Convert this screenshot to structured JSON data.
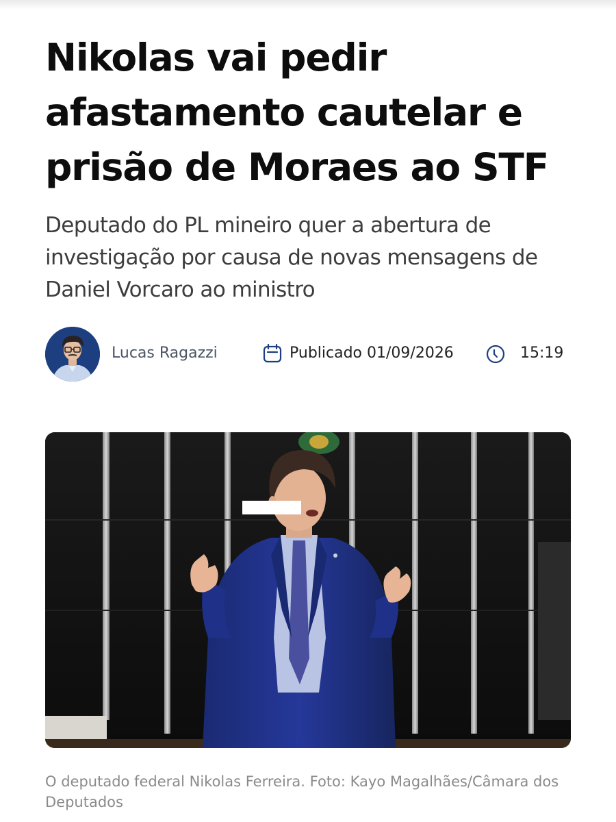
{
  "article": {
    "headline": "Nikolas vai pedir afastamento cautelar e prisão de Moraes ao STF",
    "subtitle": "Deputado do PL mineiro quer a abertura de investigação por causa de novas mensagens de Daniel Vorcaro ao ministro",
    "author": {
      "name": "Lucas Ragazzi",
      "avatar_icon": "author-avatar"
    },
    "published": {
      "label": "Publicado 01/09/2026",
      "time": "15:19",
      "date_icon": "calendar-icon",
      "time_icon": "clock-icon"
    },
    "photo": {
      "caption": "O deputado federal Nikolas Ferreira. Foto: Kayo Magalhães/Câmara dos Deputados"
    }
  },
  "colors": {
    "headline": "#0d0d0d",
    "subtitle": "#3d3d3d",
    "author_name": "#4a5566",
    "icon_accent": "#1d3f80",
    "caption": "#8a8a8a",
    "suit": "#1e2f80"
  }
}
